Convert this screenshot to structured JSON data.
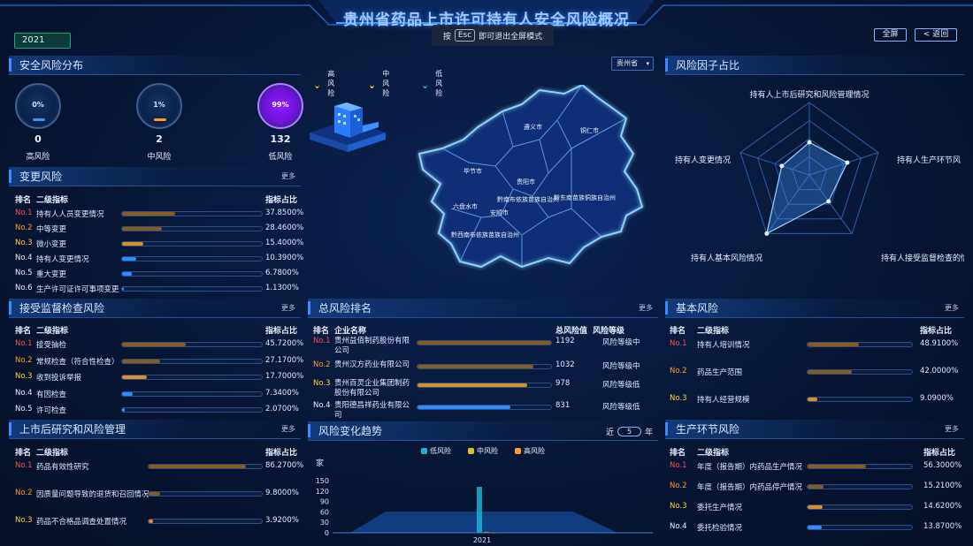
{
  "header": {
    "title": "贵州省药品上市许可持有人安全风险概况",
    "year": "2021",
    "esc_hint_pre": "按",
    "esc_key": "Esc",
    "esc_hint_post": "即可退出全屏模式",
    "fullscreen_label": "全屏",
    "back_label": "< 返回"
  },
  "safety": {
    "title": "安全风险分布",
    "gauges": [
      {
        "pct": "0%",
        "count": "0",
        "label": "高风险",
        "color": "#2f9bff"
      },
      {
        "pct": "1%",
        "count": "2",
        "label": "中风险",
        "color": "#ff9d2e"
      },
      {
        "pct": "99%",
        "count": "132",
        "label": "低风险",
        "color": "#8a1cff"
      }
    ]
  },
  "change": {
    "title": "变更风险",
    "more": "更多",
    "col_rank": "排名",
    "col_name": "二级指标",
    "col_pct": "指标占比",
    "rows": [
      {
        "rank": "No.1",
        "name": "持有人人员变更情况",
        "pct": "37.8500%",
        "value": 0.3785,
        "color": "#8a5a1c"
      },
      {
        "rank": "No.2",
        "name": "中等变更",
        "pct": "28.4600%",
        "value": 0.2846,
        "color": "#8a5a1c"
      },
      {
        "rank": "No.3",
        "name": "微小变更",
        "pct": "15.4000%",
        "value": 0.154,
        "color": "#d8902a"
      },
      {
        "rank": "No.4",
        "name": "持有人变更情况",
        "pct": "10.3900%",
        "value": 0.1039,
        "color": "#2f8cff"
      },
      {
        "rank": "No.5",
        "name": "重大变更",
        "pct": "6.7800%",
        "value": 0.0678,
        "color": "#2f8cff"
      },
      {
        "rank": "No.6",
        "name": "生产许可证许可事项变更",
        "pct": "1.1300%",
        "value": 0.0113,
        "color": "#2f8cff"
      }
    ]
  },
  "supervision": {
    "title": "接受监督检查风险",
    "more": "更多",
    "col_rank": "排名",
    "col_name": "二级指标",
    "col_pct": "指标占比",
    "rows": [
      {
        "rank": "No.1",
        "name": "接受抽检",
        "pct": "45.7200%",
        "value": 0.4572,
        "color": "#8a5a1c"
      },
      {
        "rank": "No.2",
        "name": "常规检查（符合性检查）",
        "pct": "27.1700%",
        "value": 0.2717,
        "color": "#8a5a1c"
      },
      {
        "rank": "No.3",
        "name": "收到投诉举报",
        "pct": "17.7000%",
        "value": 0.177,
        "color": "#d8902a"
      },
      {
        "rank": "No.4",
        "name": "有因检查",
        "pct": "7.3400%",
        "value": 0.0734,
        "color": "#2f8cff"
      },
      {
        "rank": "No.5",
        "name": "许可检查",
        "pct": "2.0700%",
        "value": 0.0207,
        "color": "#2f8cff"
      }
    ]
  },
  "postmarket": {
    "title": "上市后研究和风险管理",
    "more": "更多",
    "col_rank": "排名",
    "col_name": "二级指标",
    "col_pct": "指标占比",
    "rows": [
      {
        "rank": "No.1",
        "name": "药品有效性研究",
        "pct": "86.2700%",
        "value": 0.8627,
        "color": "#8a5a1c"
      },
      {
        "rank": "No.2",
        "name": "因质量问题导致的退货和召回情况",
        "pct": "9.8000%",
        "value": 0.098,
        "color": "#8a5a1c"
      },
      {
        "rank": "No.3",
        "name": "药品不合格品调查处置情况",
        "pct": "3.9200%",
        "value": 0.0392,
        "color": "#d8902a"
      }
    ]
  },
  "map": {
    "region_select": "贵州省",
    "legend": [
      "高风险",
      "中风险",
      "低风险"
    ],
    "legend_colors": [
      "#ffb020",
      "#ffd43a",
      "#1fd07a"
    ],
    "cities": [
      "遵义市",
      "铜仁市",
      "毕节市",
      "贵阳市",
      "黔东南苗族侗族自治州",
      "六盘水市",
      "黔南布依族苗族自治州",
      "安顺市",
      "黔西南布依族苗族自治州"
    ]
  },
  "total": {
    "title": "总风险排名",
    "more": "更多",
    "col_rank": "排名",
    "col_name": "企业名称",
    "col_val": "总风险值",
    "col_level": "风险等级",
    "rows": [
      {
        "rank": "No.1",
        "name": "贵州益佰制药股份有限公司",
        "value": "1192",
        "level": "风险等级中",
        "frac": 1.0,
        "color": "#8a5a1c"
      },
      {
        "rank": "No.2",
        "name": "贵州汉方药业有限公司",
        "value": "1032",
        "level": "风险等级中",
        "frac": 0.866,
        "color": "#8a5a1c"
      },
      {
        "rank": "No.3",
        "name": "贵州百灵企业集团制药股份有限公司",
        "value": "978",
        "level": "风险等级低",
        "frac": 0.82,
        "color": "#d8902a"
      },
      {
        "rank": "No.4",
        "name": "贵阳德昌祥药业有限公司",
        "value": "831",
        "level": "风险等级低",
        "frac": 0.697,
        "color": "#2f8cff"
      }
    ]
  },
  "trend": {
    "title": "风险变化趋势",
    "recent_pre": "近",
    "recent_years": "5",
    "recent_post": "年",
    "series": [
      "低风险",
      "中风险",
      "高风险"
    ],
    "series_colors": [
      "#17b3d6",
      "#d8c31f",
      "#ff9d2e"
    ],
    "ylabel": "家",
    "chart_data": {
      "type": "bar",
      "categories": [
        "2021"
      ],
      "series": [
        {
          "name": "低风险",
          "values": [
            132
          ]
        },
        {
          "name": "中风险",
          "values": [
            2
          ]
        },
        {
          "name": "高风险",
          "values": [
            0
          ]
        }
      ],
      "yticks": [
        "150",
        "120",
        "90",
        "60",
        "30",
        "0"
      ],
      "ylim": [
        0,
        150
      ]
    }
  },
  "factor": {
    "title": "风险因子占比",
    "labels": [
      "持有人上市后研究和风险管理情况",
      "持有人生产环节风",
      "持有人接受监督检查的情况",
      "持有人基本风险情况",
      "持有人变更情况"
    ],
    "values": [
      0.45,
      0.55,
      0.45,
      1.0,
      0.4
    ]
  },
  "basic": {
    "title": "基本风险",
    "more": "更多",
    "col_rank": "排名",
    "col_name": "二级指标",
    "col_pct": "指标占比",
    "rows": [
      {
        "rank": "No.1",
        "name": "持有人培训情况",
        "pct": "48.9100%",
        "value": 0.4891,
        "color": "#8a5a1c"
      },
      {
        "rank": "No.2",
        "name": "药品生产范围",
        "pct": "42.0000%",
        "value": 0.42,
        "color": "#8a5a1c"
      },
      {
        "rank": "No.3",
        "name": "持有人经营规模",
        "pct": "9.0900%",
        "value": 0.0909,
        "color": "#d8902a"
      }
    ]
  },
  "production": {
    "title": "生产环节风险",
    "more": "更多",
    "col_rank": "排名",
    "col_name": "二级指标",
    "col_pct": "指标占比",
    "rows": [
      {
        "rank": "No.1",
        "name": "年度（报告期）内药品生产情况",
        "pct": "56.3000%",
        "value": 0.563,
        "color": "#8a5a1c"
      },
      {
        "rank": "No.2",
        "name": "年度（报告期）内药品停产情况",
        "pct": "15.2100%",
        "value": 0.1521,
        "color": "#8a5a1c"
      },
      {
        "rank": "No.3",
        "name": "委托生产情况",
        "pct": "14.6200%",
        "value": 0.1462,
        "color": "#d8902a"
      },
      {
        "rank": "No.4",
        "name": "委托检验情况",
        "pct": "13.8700%",
        "value": 0.1387,
        "color": "#2f8cff"
      }
    ]
  }
}
